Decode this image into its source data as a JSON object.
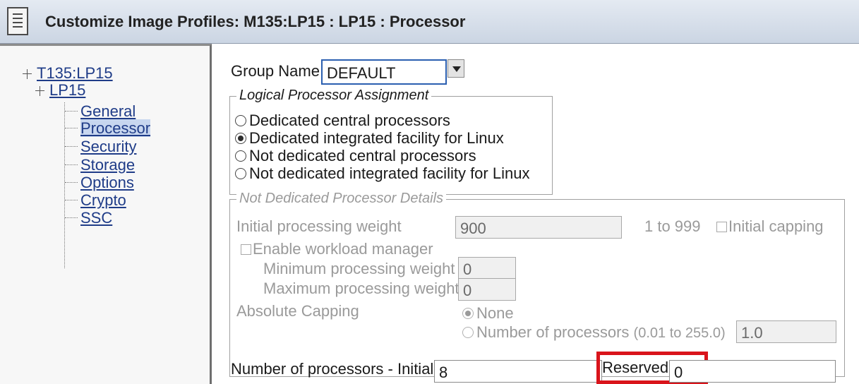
{
  "window": {
    "title_prefix": "Customize Image Profiles: M135:LP15 : LP15 : ",
    "title_section": "Processor",
    "icon": "document-icon"
  },
  "nav": {
    "root": "T135:LP15",
    "partition": "LP15",
    "items": [
      "General",
      "Processor",
      "Security",
      "Storage",
      "Options",
      "Crypto",
      "SSC"
    ],
    "selected": "Processor"
  },
  "group": {
    "label": "Group Name",
    "value": "DEFAULT"
  },
  "assignment": {
    "legend": "Logical Processor Assignment",
    "options": [
      "Dedicated central processors",
      "Dedicated integrated facility for Linux",
      "Not dedicated central processors",
      "Not dedicated integrated facility for Linux"
    ],
    "selected_index": 1
  },
  "details": {
    "legend": "Not Dedicated Processor Details",
    "initial_weight_label": "Initial processing weight",
    "initial_weight_value": "900",
    "range": "1 to 999",
    "initial_capping_label": "Initial capping",
    "wlm_label": "Enable workload manager",
    "min_weight_label": "Minimum processing weight",
    "min_weight_value": "0",
    "max_weight_label": "Maximum processing weight",
    "max_weight_value": "0",
    "capping_label": "Absolute Capping",
    "capping_none": "None",
    "capping_number": "Number of processors",
    "capping_range": "(0.01 to 255.0)",
    "capping_value": "1.0"
  },
  "processors": {
    "initial_label": "Number of processors - Initial",
    "initial_value": "8",
    "reserved_label": "Reserved",
    "reserved_value": "0"
  },
  "colors": {
    "highlight": "#d9141b",
    "link": "#1f3c88",
    "focus_border": "#2b5fb0"
  }
}
